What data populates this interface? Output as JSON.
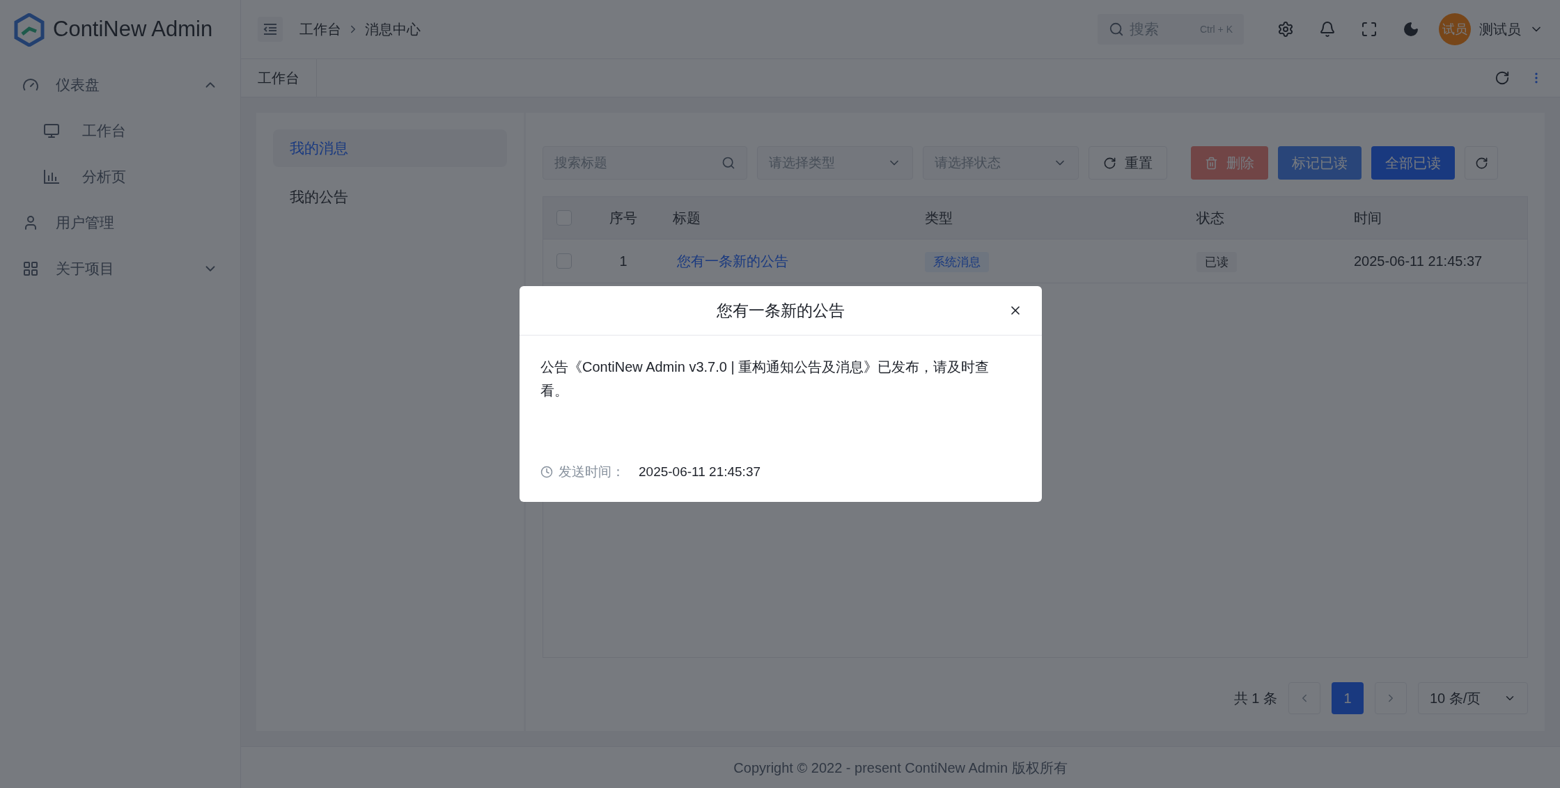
{
  "app": {
    "logo_text": "ContiNew Admin"
  },
  "sidebar": {
    "items": [
      {
        "label": "仪表盘",
        "expanded": true,
        "children": [
          {
            "label": "工作台"
          },
          {
            "label": "分析页"
          }
        ]
      },
      {
        "label": "用户管理"
      },
      {
        "label": "关于项目",
        "expanded": false
      }
    ]
  },
  "header": {
    "breadcrumb": [
      "工作台",
      "消息中心"
    ],
    "search": {
      "placeholder": "搜索",
      "shortcut": "Ctrl + K"
    },
    "user": {
      "avatar_text": "试员",
      "name": "测试员"
    }
  },
  "tabs": [
    "工作台"
  ],
  "side_menu": [
    {
      "label": "我的消息",
      "selected": true
    },
    {
      "label": "我的公告",
      "selected": false
    }
  ],
  "toolbar": {
    "search": {
      "placeholder": "搜索标题"
    },
    "selects": [
      {
        "placeholder": "请选择类型"
      },
      {
        "placeholder": "请选择状态"
      }
    ],
    "buttons": [
      {
        "kind": "reset",
        "label": "重置",
        "disabled": false
      },
      {
        "kind": "danger",
        "label": "删除",
        "disabled": true
      },
      {
        "kind": "primary",
        "label": "标记已读",
        "disabled": true
      },
      {
        "kind": "primary",
        "label": "全部已读",
        "disabled": false
      }
    ]
  },
  "table": {
    "header_checked": false,
    "columns": [
      "序号",
      "标题",
      "类型",
      "状态",
      "时间"
    ],
    "rows": [
      {
        "checked": false,
        "index": "1",
        "title": "您有一条新的公告",
        "type": "系统消息",
        "status": "已读",
        "time": "2025-06-11 21:45:37"
      }
    ]
  },
  "pagination": {
    "total": "共 1 条",
    "pages": [
      {
        "label": "1",
        "selected": true
      }
    ],
    "page_size": "10 条/页"
  },
  "footer": "Copyright © 2022 - present ContiNew Admin 版权所有",
  "modal": {
    "title": "您有一条新的公告",
    "body": "公告《ContiNew Admin v3.7.0 | 重构通知公告及消息》已发布，请及时查看。",
    "time_label": "发送时间：",
    "time": "2025-06-11 21:45:37"
  }
}
